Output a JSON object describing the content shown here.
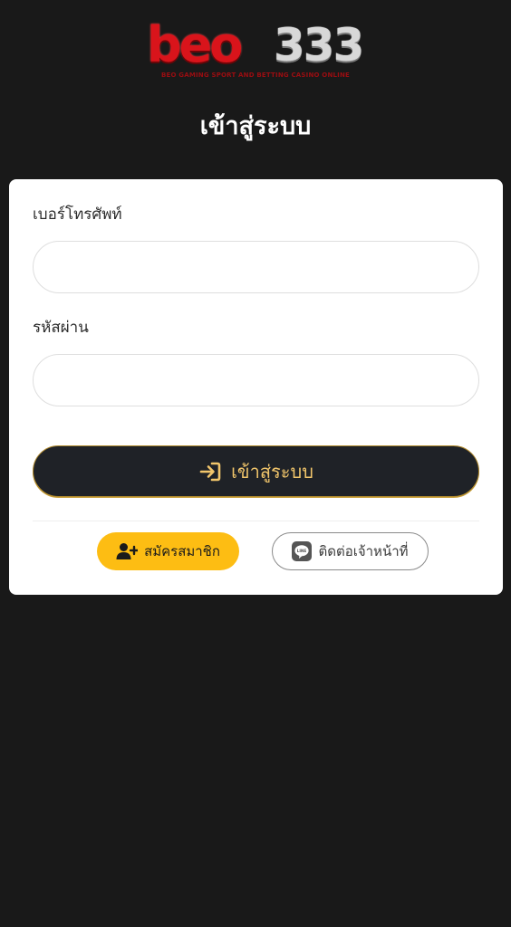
{
  "logo": {
    "brand": "beo",
    "number": "333",
    "tagline": "BEO GAMING SPORT AND BETTING CASINO ONLINE"
  },
  "page": {
    "title": "เข้าสู่ระบบ"
  },
  "form": {
    "phone": {
      "label": "เบอร์โทรศัพท์",
      "value": "",
      "placeholder": ""
    },
    "password": {
      "label": "รหัสผ่าน",
      "value": "",
      "placeholder": ""
    },
    "login_button": {
      "label": "เข้าสู่ระบบ",
      "icon": "sign-in-icon"
    }
  },
  "actions": {
    "register": {
      "label": "สมัครสมาชิก",
      "icon": "user-plus-icon"
    },
    "contact": {
      "label": "ติดต่อเจ้าหน้าที่",
      "icon": "line-icon"
    }
  },
  "colors": {
    "background": "#191919",
    "card": "#ffffff",
    "login_button_bg": "#1f2227",
    "login_button_text": "#f2c66b",
    "register_button_bg": "#fdbd13",
    "brand_red": "#d9141b"
  }
}
